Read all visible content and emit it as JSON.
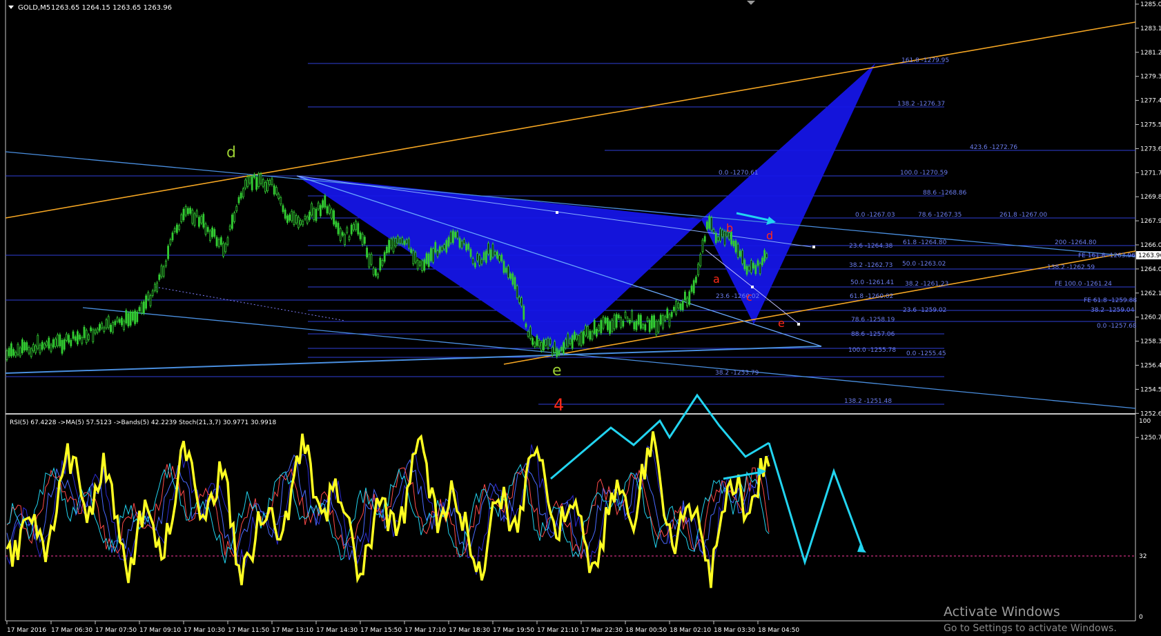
{
  "header": {
    "symbol": "GOLD,M5",
    "ohlc": "1263.65 1264.15 1263.65 1263.96"
  },
  "current_price": "1263.96",
  "price_axis": [
    "1285.05",
    "1283.15",
    "1281.25",
    "1279.35",
    "1277.40",
    "1275.50",
    "1273.60",
    "1271.70",
    "1269.80",
    "1267.90",
    "1266.00",
    "1264.05",
    "1262.15",
    "1260.25",
    "1258.35",
    "1256.45",
    "1254.55",
    "1252.65",
    "1250.75"
  ],
  "time_axis": [
    "17 Mar 2016",
    "17 Mar 06:30",
    "17 Mar 07:50",
    "17 Mar 09:10",
    "17 Mar 10:30",
    "17 Mar 11:50",
    "17 Mar 13:10",
    "17 Mar 14:30",
    "17 Mar 15:50",
    "17 Mar 17:10",
    "17 Mar 18:30",
    "17 Mar 19:50",
    "17 Mar 21:10",
    "17 Mar 22:30",
    "18 Mar 00:50",
    "18 Mar 02:10",
    "18 Mar 03:30",
    "18 Mar 04:50"
  ],
  "indicator": {
    "label": "RSI(5) 67.4228  ->MA(5) 57.5123  ->Bands(5) 42.2239  Stoch(21,3,7) 30.9771 30.9918",
    "axis": [
      "100",
      "32",
      "0"
    ]
  },
  "wave_labels": {
    "green_d": "d",
    "green_e": "e",
    "red_4": "4",
    "red_a": "a",
    "red_b": "b",
    "red_c": "c",
    "red_d": "d",
    "red_e": "e"
  },
  "fib_labels": [
    "161.8 -1279.95",
    "138.2 -1276.37",
    "423.6 -1272.76",
    "0.0 -1270.61",
    "100.0 -1270.59",
    "88.6 -1268.86",
    "0.0 -1267.03",
    "78.6 -1267.35",
    "261.8 -1267.00",
    "23.6 -1264.38",
    "61.8 -1264.80",
    "200 -1264.80",
    "FE 161.8 -1263.96",
    "38.2 -1262.73",
    "50.0 -1263.02",
    "138.2 -1262.59",
    "50.0 -1261.41",
    "38.2 -1261.23",
    "FE 100.0 -1261.24",
    "23.6 -1260.02",
    "61.8 -1260.02",
    "FE 61.8 -1259.88",
    "23.6 -1259.02",
    "38.2 -1259.04",
    "78.6 -1258.19",
    "0.0 -1257.68",
    "88.6 -1257.06",
    "100.0 -1255.78",
    "0.0 -1255.45",
    "38.2 -1253.79",
    "138.2 -1251.48"
  ],
  "watermark": {
    "title": "Activate Windows",
    "subtitle": "Go to Settings to activate Windows."
  },
  "colors": {
    "background": "#000000",
    "candles": "#33cc33",
    "fib_line": "#2f3fd8",
    "pattern_fill": "#1515e6",
    "trendline": "#f5a623",
    "channel": "#4a8fe0",
    "rsi": "#ffff22",
    "arrows": "#22d4f0",
    "wave_green": "#9acd32",
    "wave_red": "#ff2a1a"
  }
}
